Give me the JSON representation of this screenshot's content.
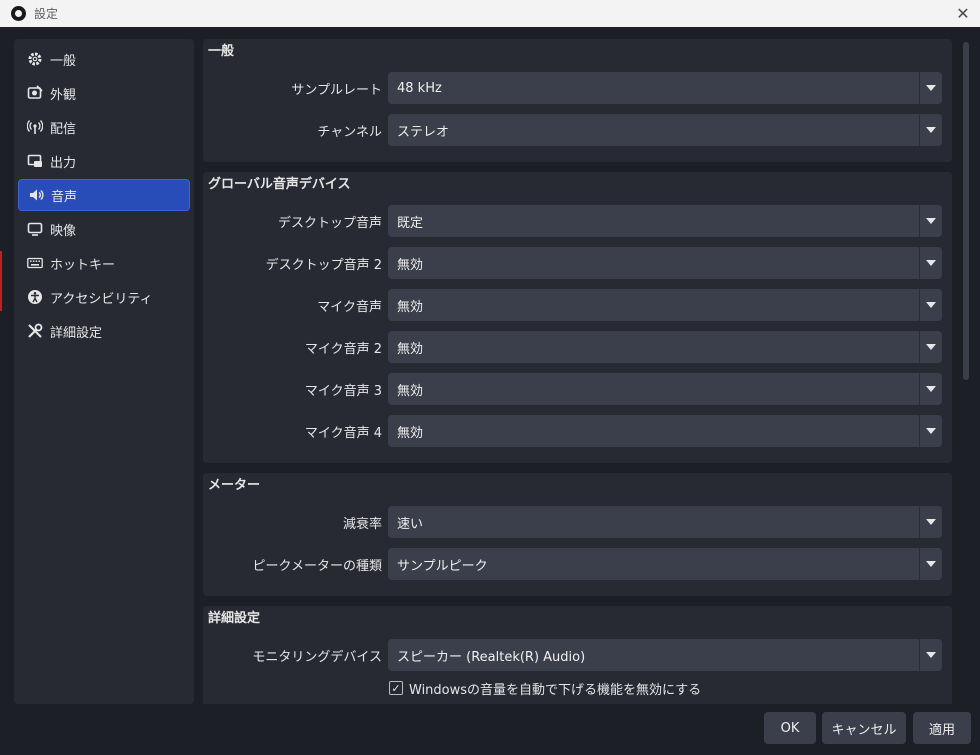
{
  "window": {
    "title": "設定",
    "close_glyph": "✕"
  },
  "sidebar": {
    "items": [
      {
        "label": "一般",
        "icon": "gear-icon"
      },
      {
        "label": "外観",
        "icon": "appearance-icon"
      },
      {
        "label": "配信",
        "icon": "antenna-icon"
      },
      {
        "label": "出力",
        "icon": "output-icon"
      },
      {
        "label": "音声",
        "icon": "speaker-icon",
        "active": true
      },
      {
        "label": "映像",
        "icon": "monitor-icon"
      },
      {
        "label": "ホットキー",
        "icon": "keyboard-icon"
      },
      {
        "label": "アクセシビリティ",
        "icon": "accessibility-icon"
      },
      {
        "label": "詳細設定",
        "icon": "tools-icon"
      }
    ]
  },
  "general": {
    "title": "一般",
    "sample_rate": {
      "label": "サンプルレート",
      "value": "48 kHz"
    },
    "channels": {
      "label": "チャンネル",
      "value": "ステレオ"
    }
  },
  "global_audio": {
    "title": "グローバル音声デバイス",
    "rows": [
      {
        "label": "デスクトップ音声",
        "value": "既定"
      },
      {
        "label": "デスクトップ音声 2",
        "value": "無効"
      },
      {
        "label": "マイク音声",
        "value": "無効"
      },
      {
        "label": "マイク音声 2",
        "value": "無効"
      },
      {
        "label": "マイク音声 3",
        "value": "無効"
      },
      {
        "label": "マイク音声 4",
        "value": "無効"
      }
    ]
  },
  "meters": {
    "title": "メーター",
    "decay": {
      "label": "減衰率",
      "value": "速い"
    },
    "peak_type": {
      "label": "ピークメーターの種類",
      "value": "サンプルピーク"
    }
  },
  "advanced": {
    "title": "詳細設定",
    "monitoring": {
      "label": "モニタリングデバイス",
      "value": "スピーカー (Realtek(R) Audio)"
    },
    "ducking": {
      "label": "Windowsの音量を自動で下げる機能を無効にする",
      "checked": true,
      "check_glyph": "✓"
    }
  },
  "buttons": {
    "ok": "OK",
    "cancel": "キャンセル",
    "apply": "適用"
  },
  "colors": {
    "accent": "#284cb8",
    "panel": "#272a33",
    "background": "#1d1f26",
    "combo": "#3b3f4b"
  }
}
